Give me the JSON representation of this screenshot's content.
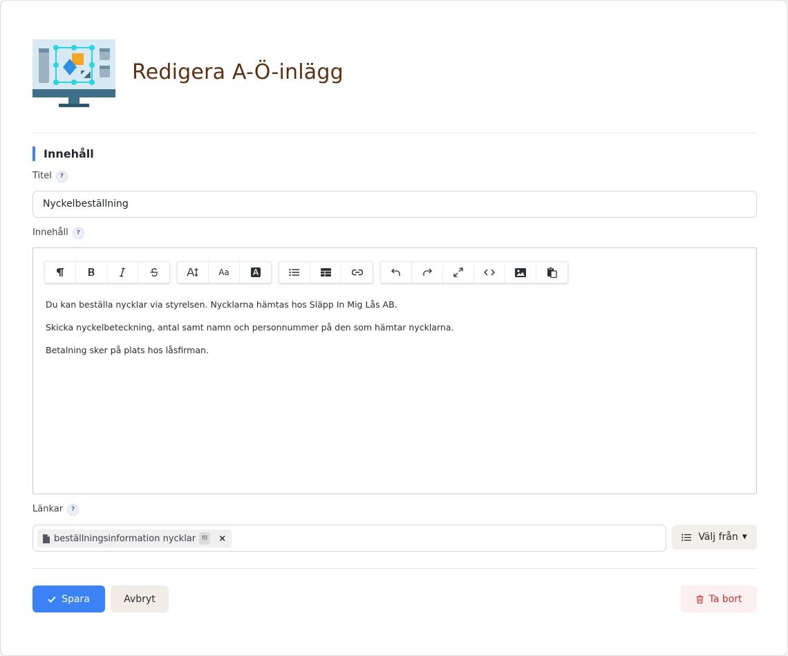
{
  "header": {
    "title": "Redigera A-Ö-inlägg"
  },
  "section": {
    "heading": "Innehåll"
  },
  "fields": {
    "title": {
      "label": "Titel",
      "value": "Nyckelbeställning"
    },
    "content": {
      "label": "Innehåll",
      "paragraphs": [
        "Du kan beställa nycklar via styrelsen. Nycklarna hämtas hos Släpp In Mig Lås AB.",
        "Skicka nyckelbeteckning, antal samt namn och personnummer på den som hämtar nycklarna.",
        "Betalning sker på plats hos låsfirman."
      ]
    },
    "links": {
      "label": "Länkar",
      "items": [
        {
          "name": "beställningsinformation nycklar",
          "type": "fil"
        }
      ],
      "choose_label": "Välj från"
    }
  },
  "toolbar": {
    "groups": [
      [
        "paragraph-icon",
        "bold-icon",
        "italic-icon",
        "strikethrough-icon"
      ],
      [
        "font-size-icon",
        "font-family-icon",
        "text-color-icon"
      ],
      [
        "list-icon",
        "table-icon",
        "link-icon"
      ],
      [
        "undo-icon",
        "redo-icon",
        "fullscreen-icon",
        "code-view-icon",
        "image-icon",
        "paste-icon"
      ]
    ]
  },
  "actions": {
    "save_label": "Spara",
    "cancel_label": "Avbryt",
    "delete_label": "Ta bort"
  },
  "colors": {
    "accent": "#3b82f6",
    "title": "#5b2f12",
    "danger": "#d32f2f"
  }
}
